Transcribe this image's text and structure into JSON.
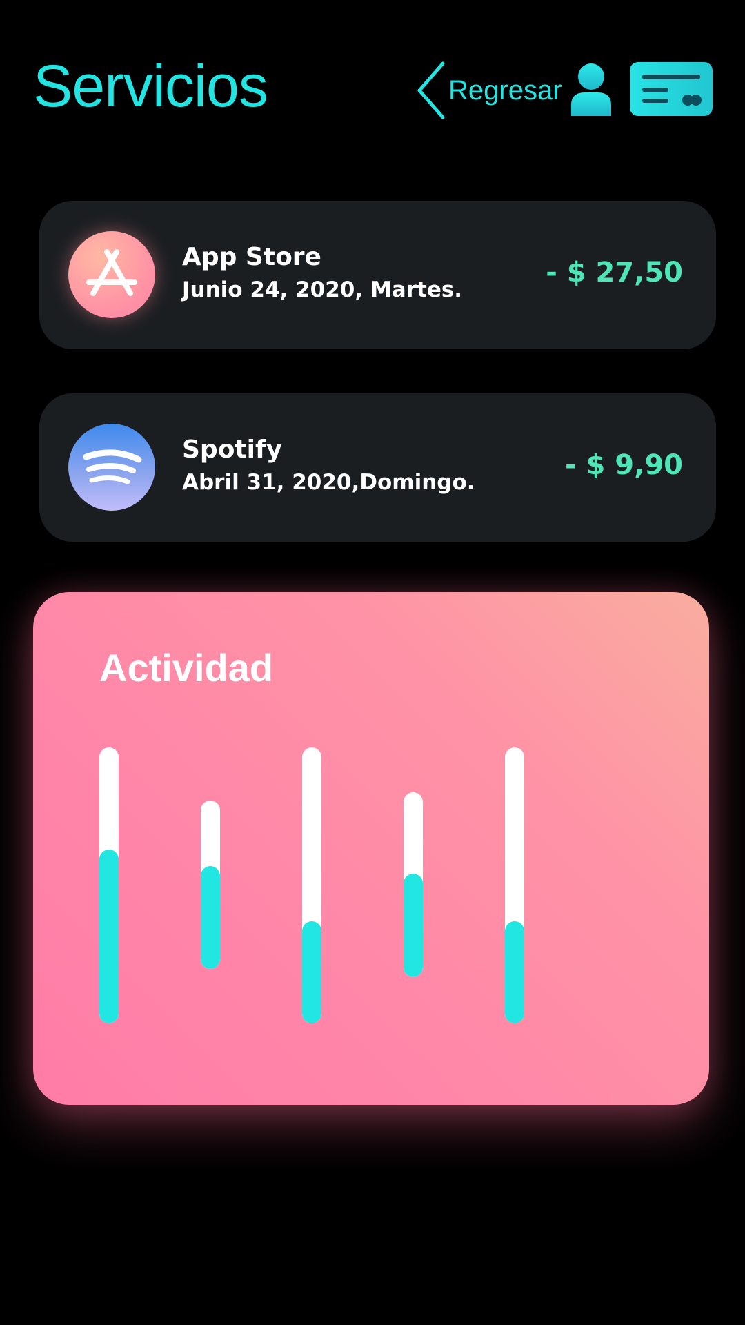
{
  "header": {
    "title": "Servicios",
    "back_label": "Regresar",
    "accent_color": "#22E4E2"
  },
  "icons": {
    "back": "chevron-left-icon",
    "user": "user-icon",
    "card": "credit-card-icon",
    "app_store": "app-store-icon",
    "spotify": "spotify-icon"
  },
  "transactions": [
    {
      "name": "App Store",
      "date": "Junio 24, 2020, Martes.",
      "amount": "- $ 27,50"
    },
    {
      "name": "Spotify",
      "date": "Abril 31, 2020,Domingo.",
      "amount": "- $ 9,90"
    }
  ],
  "activity": {
    "title": "Actividad",
    "colors": {
      "track": "#FFFFFF",
      "fill": "#22E6E2",
      "amount": "#4EE6B5"
    }
  },
  "chart_data": {
    "type": "bar",
    "title": "Actividad",
    "series": [
      {
        "values": [
          0.63,
          0.61,
          0.37,
          0.56,
          0.37
        ]
      }
    ]
  }
}
